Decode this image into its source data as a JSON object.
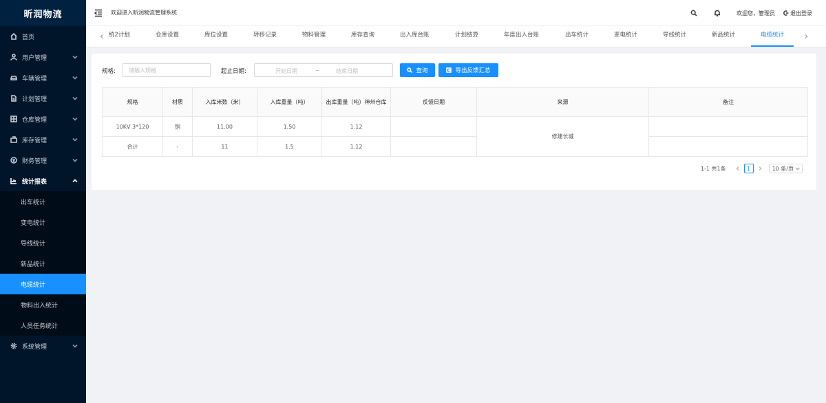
{
  "app": {
    "title": "昕润物流",
    "welcome": "欢迎进入昕润物流管理系统"
  },
  "header": {
    "greeting": "欢迎您，管理员",
    "logout_label": "退出登录"
  },
  "sidebar": {
    "items": [
      {
        "label": "首页",
        "icon": "home-icon"
      },
      {
        "label": "用户管理",
        "icon": "user-icon"
      },
      {
        "label": "车辆管理",
        "icon": "car-icon"
      },
      {
        "label": "计划管理",
        "icon": "file-icon"
      },
      {
        "label": "仓库管理",
        "icon": "warehouse-icon"
      },
      {
        "label": "库存管理",
        "icon": "stock-icon"
      },
      {
        "label": "财务管理",
        "icon": "finance-icon"
      },
      {
        "label": "统计报表",
        "icon": "chart-icon"
      },
      {
        "label": "系统管理",
        "icon": "gear-icon"
      }
    ],
    "sub_items": [
      {
        "label": "出车统计"
      },
      {
        "label": "变电统计"
      },
      {
        "label": "导线统计"
      },
      {
        "label": "新品统计"
      },
      {
        "label": "电缆统计"
      },
      {
        "label": "物料出入统计"
      },
      {
        "label": "人员任务统计"
      }
    ]
  },
  "tabs": [
    {
      "label": "统2计划"
    },
    {
      "label": "仓库设置"
    },
    {
      "label": "库位设置"
    },
    {
      "label": "转移记录"
    },
    {
      "label": "物料管理"
    },
    {
      "label": "库存查询"
    },
    {
      "label": "出入库台账"
    },
    {
      "label": "计划结算"
    },
    {
      "label": "年度出入台账"
    },
    {
      "label": "出车统计"
    },
    {
      "label": "变电统计"
    },
    {
      "label": "导线统计"
    },
    {
      "label": "新品统计"
    },
    {
      "label": "电缆统计"
    }
  ],
  "filter": {
    "spec_label": "规格:",
    "spec_placeholder": "请输入规格",
    "date_label": "起止日期:",
    "start_placeholder": "开始日期",
    "separator": "~",
    "end_placeholder": "结束日期",
    "query_label": "查询",
    "export_label": "导出反馈汇总"
  },
  "table": {
    "headers": [
      "规格",
      "材质",
      "入库米数（米）",
      "入库重量（吨）",
      "出库重量（吨）神州仓库",
      "反馈日期",
      "来源",
      "备注"
    ],
    "rows": [
      [
        "10KV 3*120",
        "铜",
        "11.00",
        "1.50",
        "1.12",
        "",
        "修建长城",
        ""
      ],
      [
        "合计",
        "-",
        "11",
        "1.5",
        "1.12",
        "",
        "",
        ""
      ]
    ]
  },
  "pagination": {
    "total": "1-1 共1条",
    "current_page": "1",
    "page_size": "10 条/页"
  },
  "colors": {
    "sidebar_bg": "#001529",
    "accent": "#1890ff"
  }
}
